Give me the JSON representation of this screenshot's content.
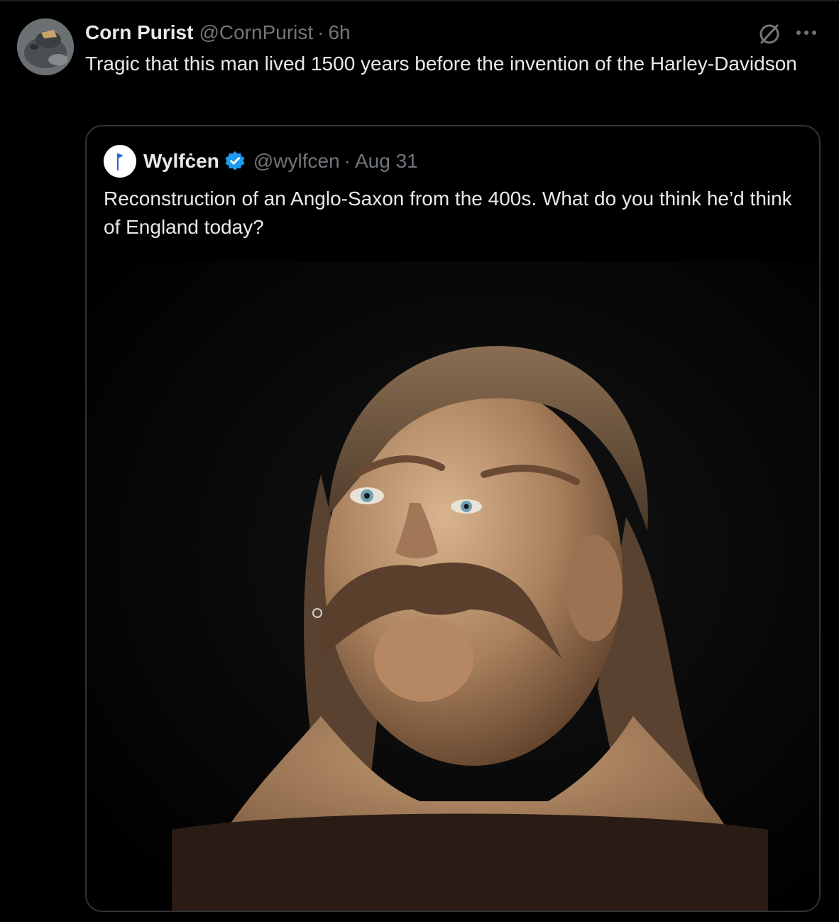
{
  "tweet": {
    "author_name": "Corn Purist",
    "author_handle": "@CornPurist",
    "separator": "·",
    "time": "6h",
    "text": "Tragic that this man lived 1500 years before the invention of the Harley-Davidson",
    "icons": {
      "avatar": "avatar-image",
      "grok": "grok-icon",
      "more": "more-icon"
    }
  },
  "quoted_tweet": {
    "author_name": "Wylfċen",
    "author_handle": "@wylfcen",
    "separator": "·",
    "date": "Aug 31",
    "text": "Reconstruction of an Anglo-Saxon from the 400s. What do you think he’d think of England today?",
    "icons": {
      "avatar": "flag-avatar",
      "verified": "verified-badge-icon"
    },
    "media": "reconstruction-photo"
  },
  "colors": {
    "background": "#000000",
    "text_primary": "#e7e9ea",
    "text_secondary": "#71767b",
    "border": "#2f3336",
    "verified_blue": "#1d9bf0"
  }
}
